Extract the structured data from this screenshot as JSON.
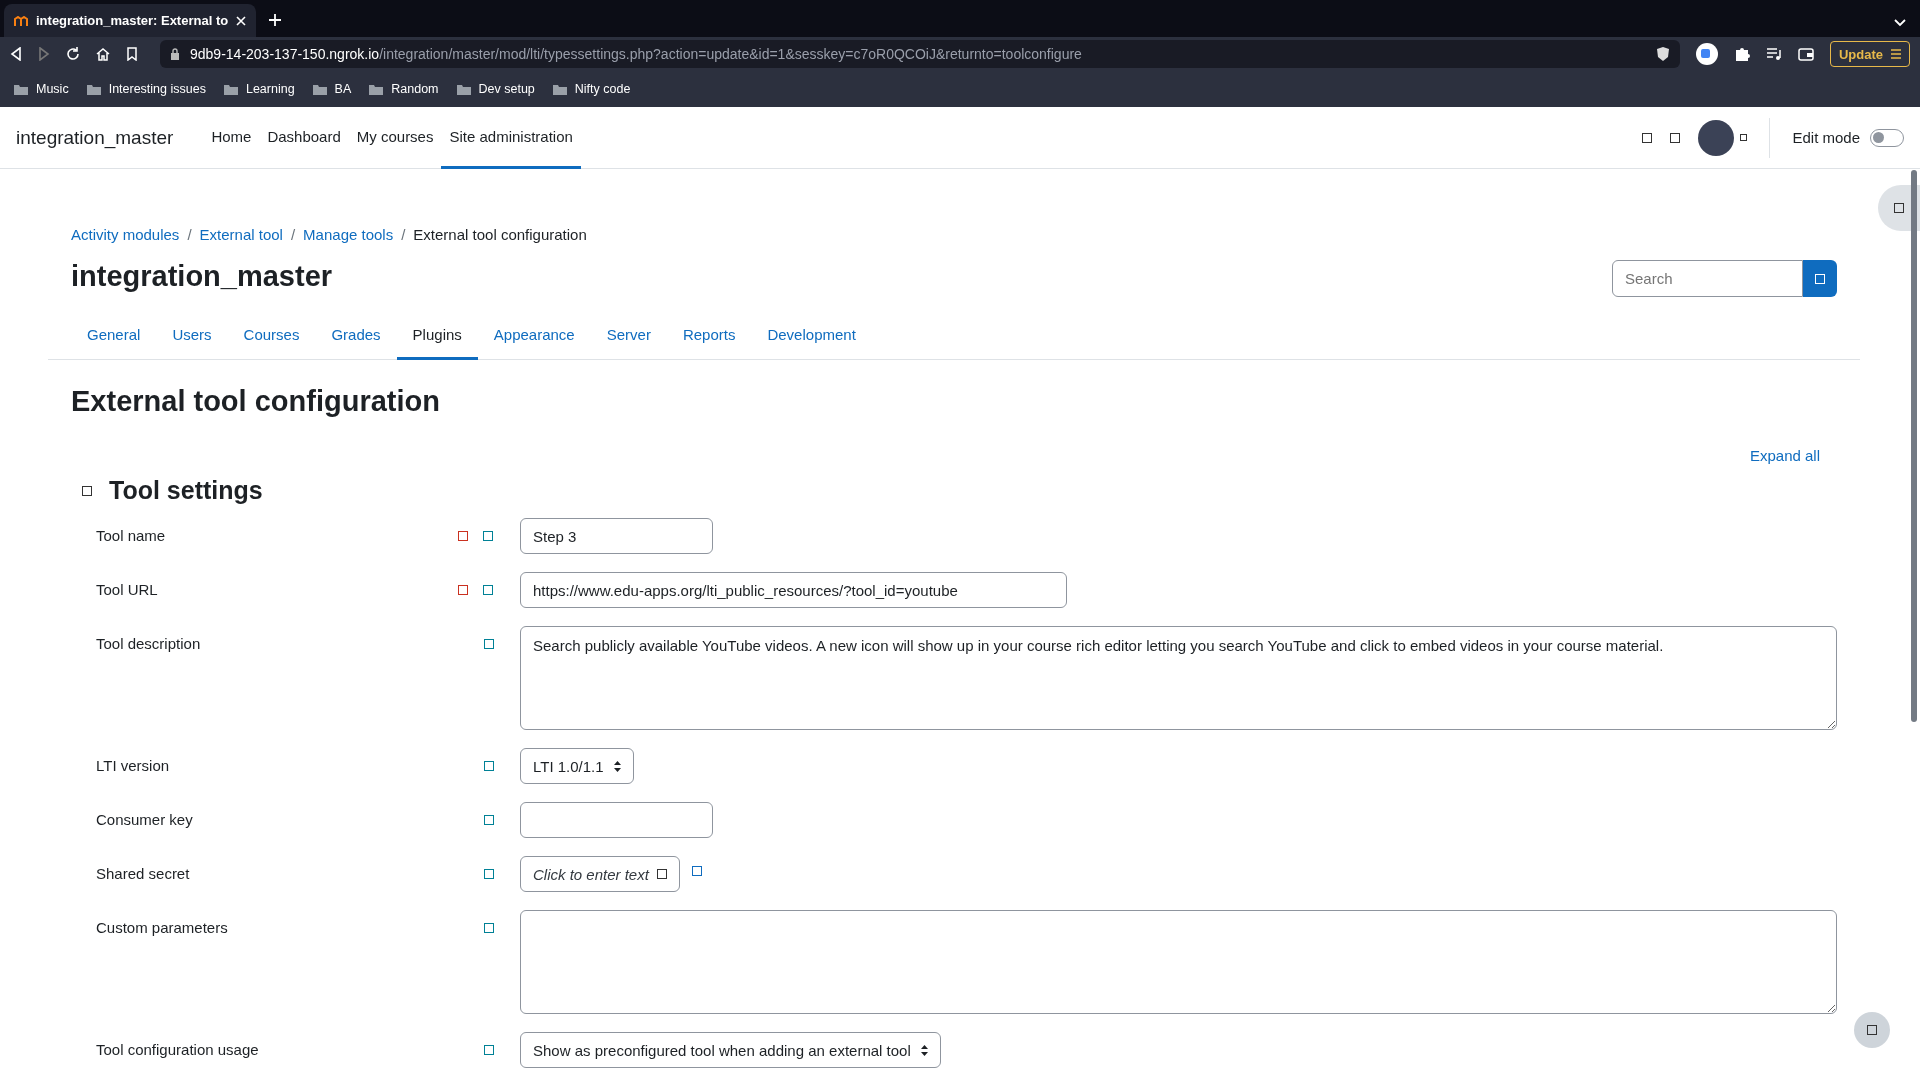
{
  "browser": {
    "tab_title": "integration_master: External to",
    "url_host": "9db9-14-203-137-150.ngrok.io",
    "url_path": "/integration/master/mod/lti/typessettings.php?action=update&id=1&sesskey=c7oR0QCOiJ&returnto=toolconfigure",
    "update_button": "Update",
    "bookmarks": [
      "Music",
      "Interesting issues",
      "Learning",
      "BA",
      "Random",
      "Dev setup",
      "Nifty code"
    ]
  },
  "header": {
    "site_name": "integration_master",
    "nav": [
      {
        "label": "Home",
        "selected": false
      },
      {
        "label": "Dashboard",
        "selected": false
      },
      {
        "label": "My courses",
        "selected": false
      },
      {
        "label": "Site administration",
        "selected": true
      }
    ],
    "edit_mode": {
      "label": "Edit mode",
      "on": false
    }
  },
  "breadcrumb": [
    {
      "label": "Activity modules",
      "kind": "link"
    },
    {
      "label": "External tool",
      "kind": "link",
      "separator": "/"
    },
    {
      "label": "Manage tools",
      "kind": "link",
      "separator": "/"
    },
    {
      "label": "External tool configuration",
      "kind": "current",
      "separator": "/"
    }
  ],
  "page_title": "integration_master",
  "search": {
    "placeholder": "Search"
  },
  "admin_tabs": [
    {
      "label": "General",
      "selected": false
    },
    {
      "label": "Users",
      "selected": false
    },
    {
      "label": "Courses",
      "selected": false
    },
    {
      "label": "Grades",
      "selected": false
    },
    {
      "label": "Plugins",
      "selected": true
    },
    {
      "label": "Appearance",
      "selected": false
    },
    {
      "label": "Server",
      "selected": false
    },
    {
      "label": "Reports",
      "selected": false
    },
    {
      "label": "Development",
      "selected": false
    }
  ],
  "heading": "External tool configuration",
  "expand_all": "Expand all",
  "section": {
    "title": "Tool settings",
    "fields": [
      {
        "label": "Tool name",
        "kind": "text",
        "value": "Step 3",
        "required": true
      },
      {
        "label": "Tool URL",
        "kind": "url",
        "value": "https://www.edu-apps.org/lti_public_resources/?tool_id=youtube",
        "required": true
      },
      {
        "label": "Tool description",
        "kind": "textarea",
        "value": "Search publicly available YouTube videos. A new icon will show up in your course rich editor letting you search YouTube and click to embed videos in your course material.",
        "required": false
      },
      {
        "label": "LTI version",
        "kind": "select",
        "value": "LTI 1.0/1.1",
        "required": false
      },
      {
        "label": "Consumer key",
        "kind": "text",
        "required": false
      },
      {
        "label": "Shared secret",
        "kind": "secret",
        "placeholder": "Click to enter text",
        "required": false
      },
      {
        "label": "Custom parameters",
        "kind": "textarea",
        "required": false
      },
      {
        "label": "Tool configuration usage",
        "kind": "select",
        "value": "Show as preconfigured tool when adding an external tool",
        "required": false
      }
    ]
  }
}
